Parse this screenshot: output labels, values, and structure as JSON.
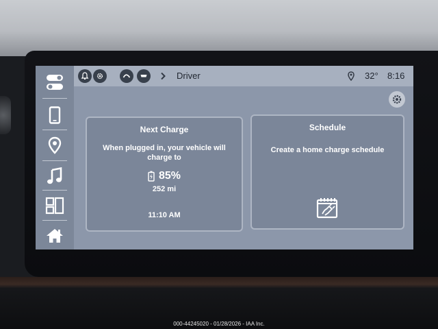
{
  "status_bar": {
    "title": "Driver",
    "temperature": "32°",
    "time": "8:16"
  },
  "next_charge": {
    "title": "Next Charge",
    "message_line1": "When plugged in, your vehicle will",
    "message_line2": "charge to",
    "charge_percent": "85%",
    "range": "252 mi",
    "time": "11:10 AM"
  },
  "schedule": {
    "title": "Schedule",
    "message": "Create a home charge schedule"
  },
  "sidebar": {
    "items": [
      "toggle-icon",
      "phone-icon",
      "location-icon",
      "music-icon",
      "apps-icon",
      "home-icon"
    ]
  },
  "watermark": "000-44245020 - 01/28/2026 - IAA Inc."
}
